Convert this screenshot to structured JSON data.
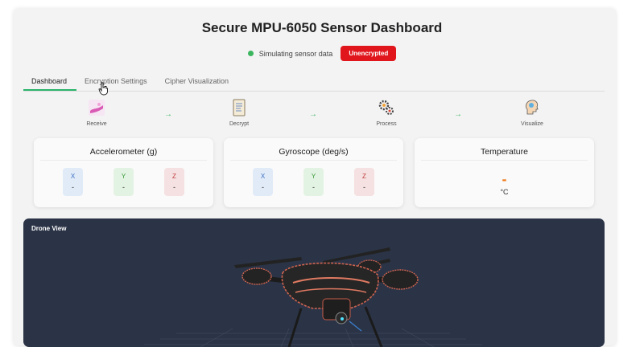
{
  "header": {
    "title": "Secure MPU-6050 Sensor Dashboard",
    "status_text": "Simulating sensor data",
    "badge": "Unencrypted",
    "status_color": "#3cb55e",
    "badge_color": "#e0161c"
  },
  "tabs": [
    {
      "label": "Dashboard",
      "active": true
    },
    {
      "label": "Encryption Settings",
      "active": false
    },
    {
      "label": "Cipher Visualization",
      "active": false
    }
  ],
  "flow": {
    "steps": [
      {
        "label": "Receive",
        "icon": "hand-receive-icon"
      },
      {
        "label": "Decrypt",
        "icon": "document-icon"
      },
      {
        "label": "Process",
        "icon": "gears-icon"
      },
      {
        "label": "Visualize",
        "icon": "head-visualize-icon"
      }
    ],
    "arrow": "→"
  },
  "cards": {
    "accelerometer": {
      "title": "Accelerometer (g)",
      "x_label": "X",
      "y_label": "Y",
      "z_label": "Z",
      "x": "-",
      "y": "-",
      "z": "-"
    },
    "gyroscope": {
      "title": "Gyroscope (deg/s)",
      "x_label": "X",
      "y_label": "Y",
      "z_label": "Z",
      "x": "-",
      "y": "-",
      "z": "-"
    },
    "temperature": {
      "title": "Temperature",
      "value": "-",
      "unit": "°C"
    }
  },
  "drone_view": {
    "title": "Drone View",
    "background": "#2b3446"
  }
}
